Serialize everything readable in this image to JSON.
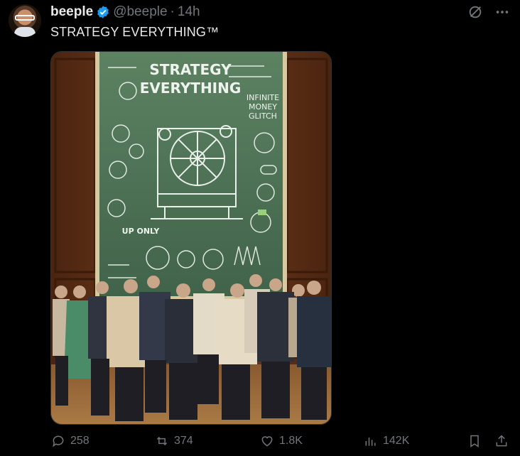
{
  "author": {
    "display_name": "beeple",
    "handle": "@beeple",
    "separator": "·",
    "timestamp": "14h",
    "verified": true
  },
  "tweet": {
    "text": "STRATEGY EVERYTHING™"
  },
  "media": {
    "board_title_line1": "STRATEGY",
    "board_title_line2": "EVERYTHING",
    "note_line1": "INFINITE",
    "note_line2": "MONEY",
    "note_line3": "GLITCH",
    "note_bottom": "UP ONLY"
  },
  "actions": {
    "replies": "258",
    "reposts": "374",
    "likes": "1.8K",
    "views": "142K"
  },
  "icons": {
    "verified_badge": "verified-badge-icon",
    "grok": "grok-icon",
    "more": "more-icon",
    "reply": "reply-icon",
    "repost": "repost-icon",
    "like": "like-icon",
    "views": "views-icon",
    "bookmark": "bookmark-icon",
    "share": "share-icon"
  },
  "colors": {
    "background": "#000000",
    "text": "#e7e9ea",
    "muted": "#71767b",
    "verified_blue": "#1d9bf0",
    "chalkboard": "#4f7356",
    "wood": "#6b3a1f"
  }
}
